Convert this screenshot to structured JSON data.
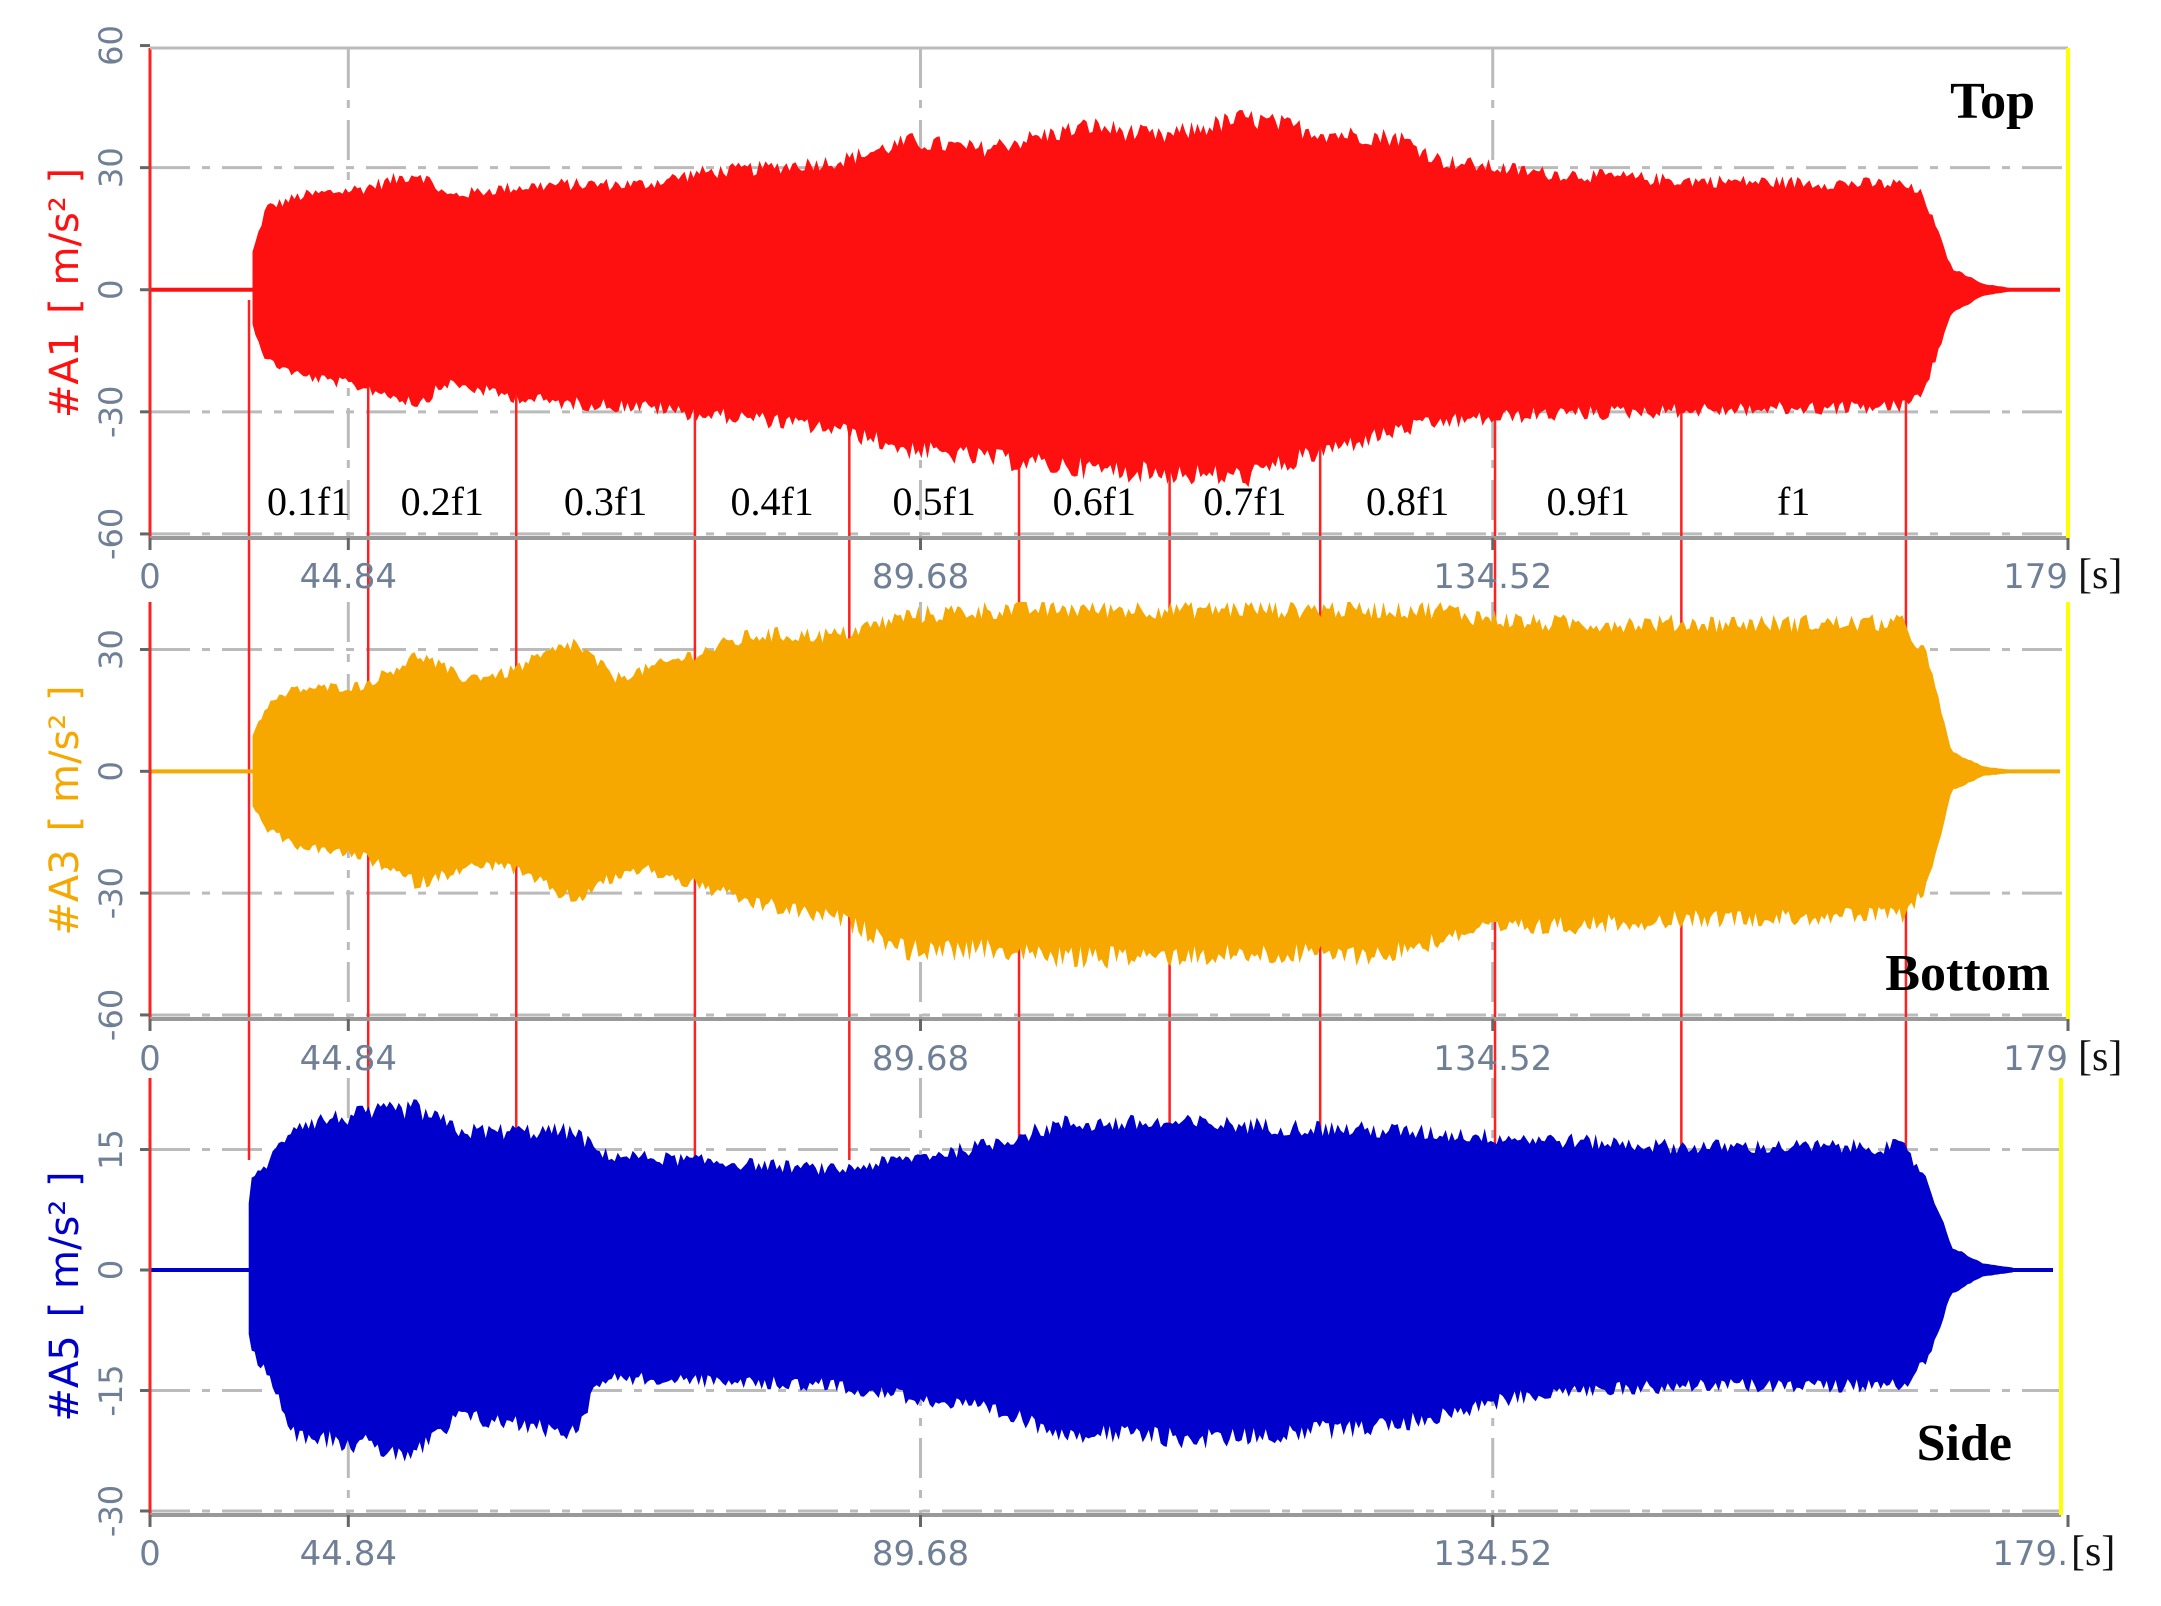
{
  "chart_data": {
    "type": "area",
    "title": "",
    "xlabel": "[s]",
    "x_ticks": [
      {
        "value": 29.3,
        "label": "0"
      },
      {
        "value": 44.84,
        "label": "44.84"
      },
      {
        "value": 89.68,
        "label": "89.68"
      },
      {
        "value": 134.52,
        "label": "134.52"
      },
      {
        "value": 179.6,
        "label": "179"
      }
    ],
    "last_tick_label_bottom": "179.",
    "xlim": [
      29.3,
      179.6
    ],
    "grid": true,
    "frequency_markers": [
      37.06,
      46.4,
      58.0,
      72.0,
      84.1,
      97.4,
      109.2,
      121.0,
      134.7,
      149.3,
      166.9
    ],
    "frequency_labels": [
      "0.1f1",
      "0.2f1",
      "0.3f1",
      "0.4f1",
      "0.5f1",
      "0.6f1",
      "0.7f1",
      "0.8f1",
      "0.9f1",
      "f1"
    ],
    "panels": [
      {
        "channel": "#A1",
        "unit": "[ m/s² ]",
        "position_label": "Top",
        "color": "#ff1010",
        "ylim": [
          -61,
          59.4
        ],
        "y_ticks": [
          -60,
          -30,
          0,
          30,
          60
        ],
        "envelope": [
          [
            37.1,
            7,
            -7
          ],
          [
            38.4,
            21,
            -18
          ],
          [
            41.1,
            24,
            -22
          ],
          [
            46,
            26,
            -25
          ],
          [
            50.4,
            30,
            -29
          ],
          [
            52.6,
            24,
            -24
          ],
          [
            57,
            26,
            -27
          ],
          [
            61.4,
            27,
            -29
          ],
          [
            68,
            27,
            -30
          ],
          [
            72.4,
            30,
            -32
          ],
          [
            76.7,
            31,
            -33
          ],
          [
            83.3,
            33,
            -36
          ],
          [
            88.8,
            38,
            -41
          ],
          [
            94.3,
            36,
            -43
          ],
          [
            103.1,
            42,
            -46
          ],
          [
            108.5,
            39,
            -47
          ],
          [
            115.1,
            44,
            -48
          ],
          [
            121.7,
            40,
            -41
          ],
          [
            127.2,
            39,
            -36
          ],
          [
            130.5,
            33,
            -34
          ],
          [
            138.1,
            30,
            -32
          ],
          [
            149.1,
            28,
            -31
          ],
          [
            166.6,
            27,
            -30
          ],
          [
            168.3,
            24,
            -26
          ],
          [
            170.5,
            5.5,
            -6
          ],
          [
            173,
            1.5,
            -1.5
          ],
          [
            175.4,
            0.3,
            -0.3
          ]
        ]
      },
      {
        "channel": "#A3",
        "unit": "[ m/s² ]",
        "position_label": "Bottom",
        "color": "#f6a800",
        "ylim": [
          -61,
          41.7
        ],
        "y_ticks": [
          -60,
          -30,
          0,
          30
        ],
        "envelope": [
          [
            37.1,
            8,
            -8
          ],
          [
            38.5,
            17,
            -15
          ],
          [
            40.6,
            21,
            -19
          ],
          [
            46,
            22,
            -22
          ],
          [
            50.4,
            30,
            -29
          ],
          [
            53.7,
            24,
            -25
          ],
          [
            57,
            25,
            -24
          ],
          [
            62.5,
            33,
            -33
          ],
          [
            65.8,
            24,
            -27
          ],
          [
            68,
            26,
            -25
          ],
          [
            76.7,
            35,
            -34
          ],
          [
            83.3,
            35,
            -38
          ],
          [
            88.8,
            40,
            -46
          ],
          [
            96.5,
            41.7,
            -46
          ],
          [
            100.9,
            41.7,
            -48
          ],
          [
            114,
            41.7,
            -47
          ],
          [
            126.1,
            41.7,
            -47
          ],
          [
            130.5,
            41.7,
            -43
          ],
          [
            132.7,
            40,
            -41
          ],
          [
            138.1,
            38,
            -40
          ],
          [
            149.1,
            38,
            -38
          ],
          [
            166.6,
            38,
            -37
          ],
          [
            168.5,
            30,
            -30
          ],
          [
            170.5,
            5,
            -5
          ],
          [
            173,
            1.2,
            -1.2
          ],
          [
            175.4,
            0.3,
            -0.3
          ]
        ]
      },
      {
        "channel": "#A5",
        "unit": "[ m/s² ]",
        "position_label": "Side",
        "color": "#0000cc",
        "ylim": [
          -30.5,
          23.9
        ],
        "y_ticks": [
          -30,
          -15,
          0,
          15
        ],
        "envelope": [
          [
            36.8,
            0.5,
            -0.5
          ],
          [
            37.1,
            11,
            -10
          ],
          [
            39,
            15,
            -15
          ],
          [
            40.6,
            19,
            -21
          ],
          [
            50,
            21,
            -24
          ],
          [
            53.7,
            18,
            -19
          ],
          [
            62.5,
            18,
            -21
          ],
          [
            64.7,
            15,
            -14
          ],
          [
            83.3,
            13,
            -15
          ],
          [
            94.3,
            16,
            -18
          ],
          [
            100.9,
            19,
            -21
          ],
          [
            111.9,
            19,
            -22
          ],
          [
            127.2,
            18,
            -20
          ],
          [
            138.1,
            17,
            -16
          ],
          [
            149.1,
            16,
            -15
          ],
          [
            166.6,
            16,
            -15
          ],
          [
            168.5,
            12,
            -12
          ],
          [
            170.5,
            3,
            -3
          ],
          [
            173,
            0.8,
            -0.8
          ],
          [
            175.4,
            0.3,
            -0.3
          ]
        ]
      }
    ]
  }
}
